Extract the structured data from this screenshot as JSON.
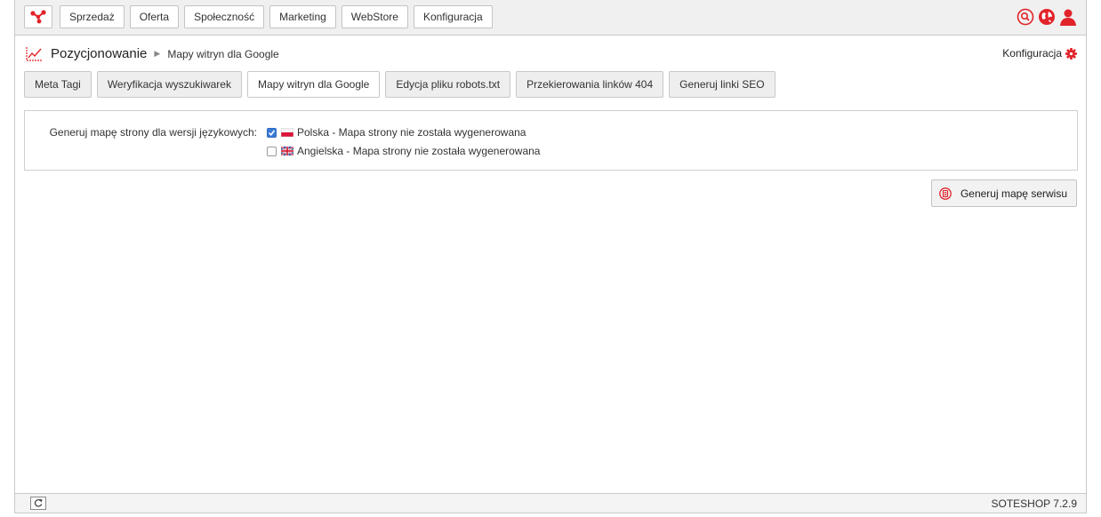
{
  "topbar": {
    "logo_icon": "soteshop-logo-icon",
    "menu": [
      "Sprzedaż",
      "Oferta",
      "Społeczność",
      "Marketing",
      "WebStore",
      "Konfiguracja"
    ],
    "icons": [
      "search-icon",
      "globe-icon",
      "user-icon"
    ]
  },
  "breadcrumb": {
    "icon": "chart-icon",
    "title": "Pozycjonowanie",
    "current": "Mapy witryn dla Google"
  },
  "config_link": {
    "label": "Konfiguracja",
    "icon": "gear-icon"
  },
  "tabs": [
    {
      "label": "Meta Tagi",
      "active": false
    },
    {
      "label": "Weryfikacja wyszukiwarek",
      "active": false
    },
    {
      "label": "Mapy witryn dla Google",
      "active": true
    },
    {
      "label": "Edycja pliku robots.txt",
      "active": false
    },
    {
      "label": "Przekierowania linków 404",
      "active": false
    },
    {
      "label": "Generuj linki SEO",
      "active": false
    }
  ],
  "form": {
    "label": "Generuj mapę strony dla wersji językowych:",
    "options": [
      {
        "label": "Polska - Mapa strony nie została wygenerowana",
        "checked": true,
        "flag": "poland-flag-icon"
      },
      {
        "label": "Angielska - Mapa strony nie została wygenerowana",
        "checked": false,
        "flag": "uk-flag-icon"
      }
    ]
  },
  "generate_button": {
    "label": "Generuj mapę serwisu",
    "icon": "generate-icon"
  },
  "footer": {
    "refresh_icon": "refresh-icon",
    "version": "SOTESHOP 7.2.9"
  },
  "colors": {
    "accent": "#e2232a",
    "checkbox": "#3a7bd5",
    "border": "#c9c9c9"
  }
}
